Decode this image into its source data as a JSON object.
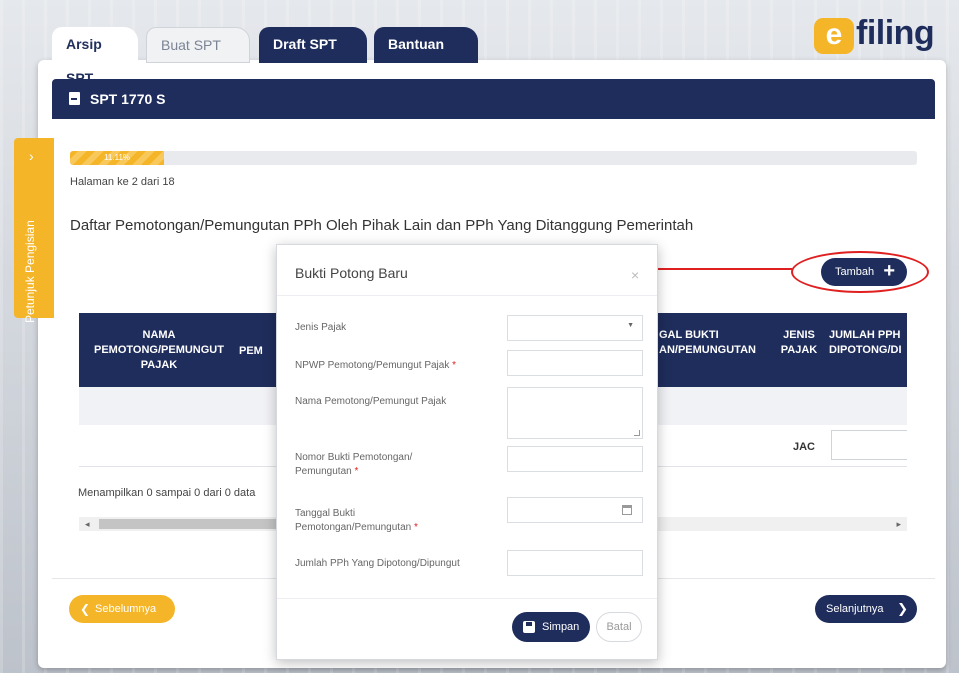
{
  "tabs": [
    {
      "label": "Arsip SPT"
    },
    {
      "label": "Buat SPT"
    },
    {
      "label": "Draft SPT"
    },
    {
      "label": "Bantuan"
    }
  ],
  "logo": {
    "letter": "e",
    "text": "filing"
  },
  "header": {
    "title": "SPT 1770 S",
    "icon": "document-icon"
  },
  "sidetab": {
    "label": "Petunjuk Pengisian",
    "chevron": "›"
  },
  "progress": {
    "label": "11.11%",
    "value": 11.11
  },
  "page_info": "Halaman ke 2 dari 18",
  "section_title": "Daftar Pemotongan/Pemungutan PPh Oleh Pihak Lain dan PPh Yang Ditanggung Pemerintah",
  "tambah_button": {
    "label": "Tambah",
    "icon": "+"
  },
  "table": {
    "headers": [
      "NAMA PEMOTONG/PEMUNGUT PAJAK",
      "PEM",
      "GAL BUKTI AN/PEMUNGUTAN",
      "JENIS PAJAK",
      "JUMLAH PPH DIPOTONG/DI"
    ],
    "footer_label": "JAC"
  },
  "showing_text": "Menampilkan 0 sampai 0 dari 0 data",
  "scroll": {
    "left": "◂",
    "right": "▸"
  },
  "buttons": {
    "prev": "Sebelumnya",
    "next": "Selanjutnya"
  },
  "modal": {
    "title": "Bukti Potong Baru",
    "close": "×",
    "fields": [
      {
        "label": "Jenis Pajak",
        "required": false,
        "type": "select"
      },
      {
        "label": "NPWP Pemotong/Pemungut Pajak",
        "required": true,
        "type": "text"
      },
      {
        "label": "Nama Pemotong/Pemungut Pajak",
        "required": false,
        "type": "textarea"
      },
      {
        "label": "Nomor Bukti Pemotongan/ Pemungutan",
        "required": true,
        "type": "text"
      },
      {
        "label": "Tanggal Bukti Pemotongan/Pemungutan",
        "required": true,
        "type": "date"
      },
      {
        "label": "Jumlah PPh Yang Dipotong/Dipungut",
        "required": false,
        "type": "text"
      }
    ],
    "save_label": "Simpan",
    "cancel_label": "Batal"
  },
  "colors": {
    "navy": "#1f2d5c",
    "accent": "#f5b529",
    "annotation": "#e02020"
  }
}
